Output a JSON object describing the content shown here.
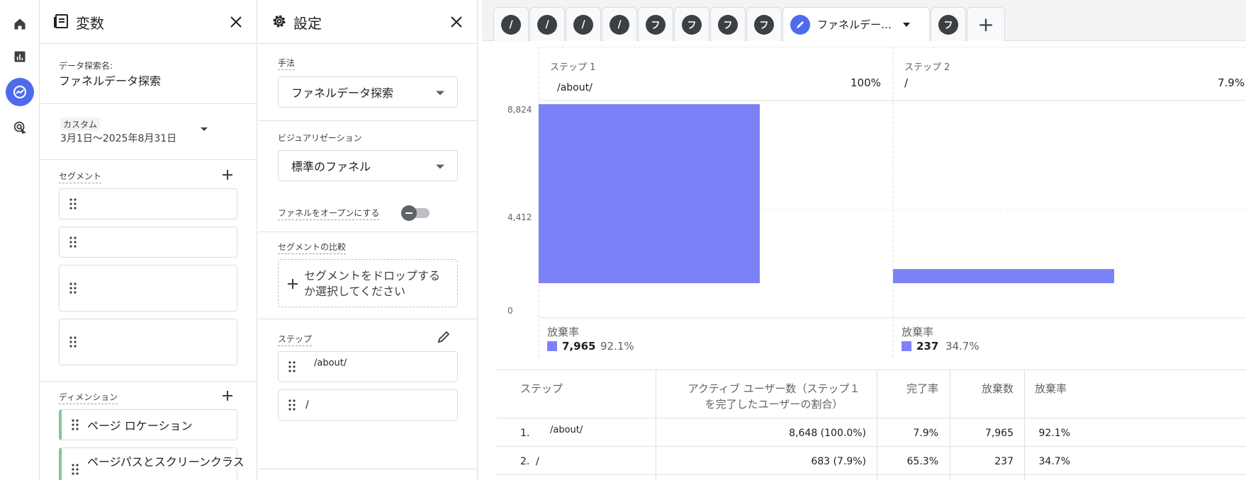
{
  "variables_panel": {
    "title": "変数",
    "exploration_name_label": "データ探索名:",
    "exploration_name": "ファネルデータ探索",
    "date_badge": "カスタム",
    "date_range": "3月1日～2025年8月31日",
    "segments_label": "セグメント",
    "dimensions_label": "ディメンション",
    "dimensions": [
      "ページ ロケーション",
      "ページパスとスクリーンクラス"
    ]
  },
  "settings_panel": {
    "title": "設定",
    "technique_label": "手法",
    "technique_value": "ファネルデータ探索",
    "visualization_label": "ビジュアリゼーション",
    "visualization_value": "標準のファネル",
    "open_funnel_label": "ファネルをオープンにする",
    "segment_compare_label": "セグメントの比較",
    "segment_drop_text_line1": "セグメントをドロップする",
    "segment_drop_text_line2": "か選択してください",
    "steps_label": "ステップ",
    "steps": [
      "/about/",
      "/"
    ]
  },
  "tabs": {
    "letters": [
      "/",
      "/",
      "/",
      "/",
      "フ",
      "フ",
      "フ",
      "フ"
    ],
    "active_label": "ファネルデー…",
    "after_letter": "フ",
    "add_label": "+"
  },
  "chart_data": {
    "type": "bar",
    "categories": [
      "ステップ 1",
      "ステップ 2"
    ],
    "step_names": [
      "/about/",
      "/"
    ],
    "step_pcts": [
      "100%",
      "7.9%"
    ],
    "values": [
      8648,
      683
    ],
    "ylim": [
      0,
      8824
    ],
    "y_ticks": [
      "8,824",
      "4,412",
      "0"
    ],
    "abandon_label": "放棄率",
    "abandon_counts": [
      "7,965",
      "237"
    ],
    "abandon_rates": [
      "92.1%",
      "34.7%"
    ],
    "bar_color": "#7b82f7"
  },
  "table": {
    "headers": [
      "ステップ",
      "アクティブ ユーザー数（ステップ１",
      "を完了したユーザーの割合）",
      "完了率",
      "放棄数",
      "放棄率"
    ],
    "rows": [
      {
        "idx": "1.",
        "step": "/about/",
        "users": "8,648 (100.0%)",
        "completion": "7.9%",
        "abandons": "7,965",
        "abandon_rate": "92.1%"
      },
      {
        "idx": "2.",
        "step": "/",
        "users": "683 (7.9%)",
        "completion": "65.3%",
        "abandons": "237",
        "abandon_rate": "34.7%"
      }
    ]
  }
}
